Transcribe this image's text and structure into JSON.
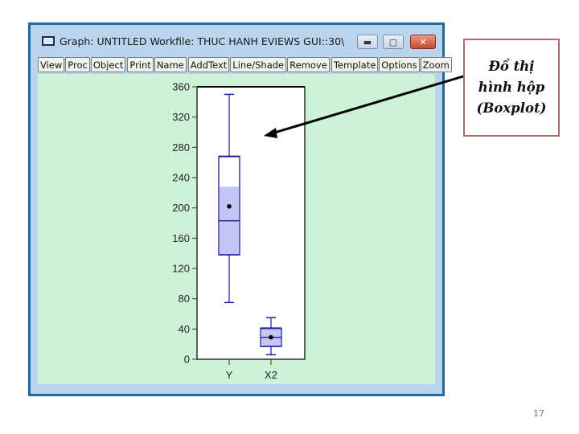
{
  "window": {
    "title": "Graph: UNTITLED   Workfile: THUC HANH EVIEWS GUI::30\\",
    "controls": {
      "minimize": "▬",
      "maximize": "▢",
      "close": "✕"
    },
    "toolbar": {
      "group1": [
        "View",
        "Proc",
        "Object"
      ],
      "group2": [
        "Print",
        "Name"
      ],
      "group3": [
        "AddText",
        "Line/Shade",
        "Remove"
      ],
      "group4": [
        "Template",
        "Options",
        "Zoom"
      ]
    }
  },
  "annotation": {
    "line1": "Đồ thị",
    "line2": "hình hộp",
    "line3": "(Boxplot)"
  },
  "page_number": "17",
  "colors": {
    "box_fill": "#c4c4f6",
    "box_stroke": "#1c1c99",
    "canvas_bg": "#cdf2d7"
  },
  "chart_data": {
    "type": "boxplot",
    "categories": [
      "Y",
      "X2"
    ],
    "ylim": [
      0,
      360
    ],
    "yticks": [
      0,
      40,
      80,
      120,
      160,
      200,
      240,
      280,
      320,
      360
    ],
    "series": [
      {
        "name": "Y",
        "whisker_low": 75,
        "q1": 138,
        "median": 183,
        "mean": 202,
        "q3": 268,
        "shade_top": 228,
        "whisker_high": 350
      },
      {
        "name": "X2",
        "whisker_low": 6,
        "q1": 17,
        "median": 29,
        "mean": 29,
        "q3": 41,
        "shade_top": 41,
        "whisker_high": 55
      }
    ],
    "title": "",
    "xlabel": "",
    "ylabel": ""
  }
}
